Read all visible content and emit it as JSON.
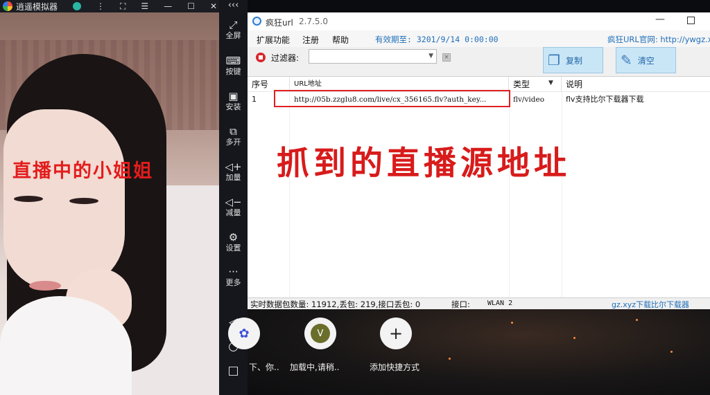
{
  "emulator": {
    "title": "逍遥模拟器",
    "overlay_text": "直播中的小姐姐",
    "sidebar": [
      {
        "icon": "fullscreen-icon",
        "glyph": "⤢",
        "label": "全屏"
      },
      {
        "icon": "keyboard-icon",
        "glyph": "⌨",
        "label": "按键"
      },
      {
        "icon": "apk-icon",
        "glyph": "▣",
        "label": "安装"
      },
      {
        "icon": "multi-instance-icon",
        "glyph": "⧉",
        "label": "多开"
      },
      {
        "icon": "volume-up-icon",
        "glyph": "◁+",
        "label": "加量"
      },
      {
        "icon": "volume-down-icon",
        "glyph": "◁−",
        "label": "减量"
      },
      {
        "icon": "settings-icon",
        "glyph": "⚙",
        "label": "设置"
      },
      {
        "icon": "more-icon",
        "glyph": "···",
        "label": "更多"
      }
    ]
  },
  "app": {
    "title": "疯狂url",
    "version": "2.7.5.0",
    "menu": [
      "扩展功能",
      "注册",
      "帮助"
    ],
    "expiry": "有效期至: 3201/9/14 0:00:00",
    "site_link": "疯狂URL官网: http://ywgz.x",
    "filter_label": "过滤器:",
    "filter_value": "",
    "copy_label": "复制",
    "clear_label": "清空",
    "columns": [
      "序号",
      "URL地址",
      "类型",
      "说明"
    ],
    "rows": [
      {
        "index": "1",
        "url": "http://05b.zzglu8.com/live/cx_356165.flv?auth_key...",
        "type": "flv/video",
        "desc": "flv支持比尔下载器下载"
      }
    ],
    "annotation": "抓到的直播源地址",
    "status": {
      "stats": "实时数据包数量: 11912,丢包: 219,接口丢包: 0",
      "iface_label": "接口:",
      "iface": "WLAN 2",
      "brand": "gz.xyz下载比尔下载器"
    }
  },
  "desktop": {
    "shortcuts": [
      {
        "label": "下、你..",
        "glyph": "✿"
      },
      {
        "label": "加载中,请稍..",
        "glyph": "V"
      },
      {
        "label": "添加快捷方式",
        "glyph": "+"
      }
    ]
  }
}
